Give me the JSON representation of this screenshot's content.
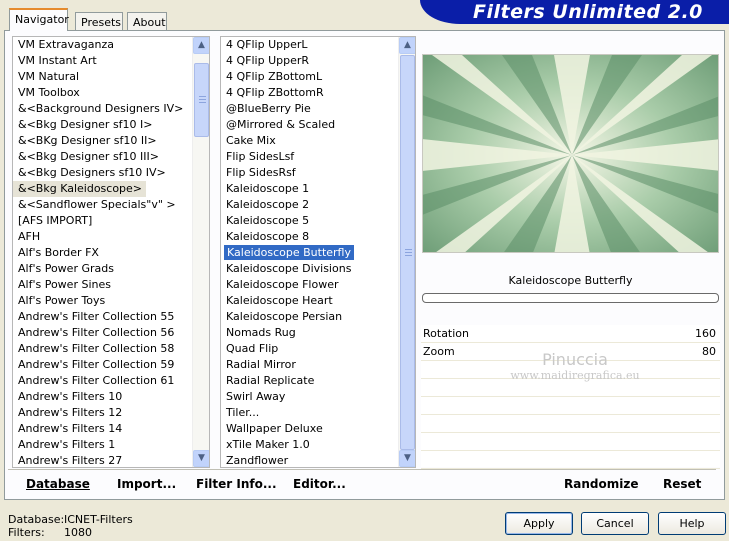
{
  "tabs": [
    "Navigator",
    "Presets",
    "About"
  ],
  "banner": "Filters Unlimited 2.0",
  "categories": [
    "VM Extravaganza",
    "VM Instant Art",
    "VM Natural",
    "VM Toolbox",
    "&<Background Designers IV>",
    "&<Bkg Designer sf10 I>",
    "&<BKg Designer sf10 II>",
    "&<Bkg Designer sf10 III>",
    "&<Bkg Designers sf10 IV>",
    "&<Bkg Kaleidoscope>",
    "&<Sandflower Specials\"v\" >",
    "[AFS IMPORT]",
    "AFH",
    "Alf's Border FX",
    "Alf's Power Grads",
    "Alf's Power Sines",
    "Alf's Power Toys",
    "Andrew's Filter Collection 55",
    "Andrew's Filter Collection 56",
    "Andrew's Filter Collection 58",
    "Andrew's Filter Collection 59",
    "Andrew's Filter Collection 61",
    "Andrew's Filters 10",
    "Andrew's Filters 12",
    "Andrew's Filters 14",
    "Andrew's Filters 1",
    "Andrew's Filters 27"
  ],
  "filters": [
    "4 QFlip UpperL",
    "4 QFlip UpperR",
    "4 QFlip ZBottomL",
    "4 QFlip ZBottomR",
    "@BlueBerry Pie",
    "@Mirrored & Scaled",
    "Cake Mix",
    "Flip SidesLsf",
    "Flip SidesRsf",
    "Kaleidoscope 1",
    "Kaleidoscope 2",
    "Kaleidoscope 5",
    "Kaleidoscope 8",
    "Kaleidoscope Butterfly",
    "Kaleidoscope Divisions",
    "Kaleidoscope Flower",
    "Kaleidoscope Heart",
    "Kaleidoscope Persian",
    "Nomads Rug",
    "Quad Flip",
    "Radial Mirror",
    "Radial Replicate",
    "Swirl Away",
    "Tiler...",
    "Wallpaper Deluxe",
    "xTile Maker 1.0",
    "Zandflower"
  ],
  "selected_filter_label": "Kaleidoscope Butterfly",
  "params": [
    {
      "label": "Rotation",
      "value": "160"
    },
    {
      "label": "Zoom",
      "value": "80"
    }
  ],
  "watermark": {
    "name": "Pinuccia",
    "url": "www.maidiregrafica.eu"
  },
  "left_buttons": {
    "database": "Database",
    "import": "Import...",
    "filter_info": "Filter Info...",
    "editor": "Editor..."
  },
  "right_buttons": {
    "randomize": "Randomize",
    "reset": "Reset"
  },
  "status": {
    "database_label": "Database:",
    "database_value": "ICNET-Filters",
    "filters_label": "Filters:",
    "filters_value": "1080"
  },
  "dialog_buttons": {
    "apply": "Apply",
    "cancel": "Cancel",
    "help": "Help"
  },
  "colors": {
    "accent_blue": "#0a1ea8",
    "selection": "#316ac5",
    "preview_green": "#7aae85"
  }
}
